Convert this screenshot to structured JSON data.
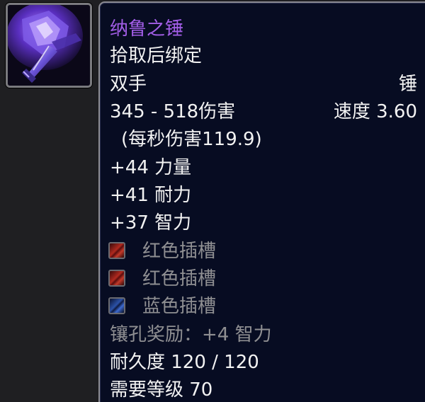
{
  "item": {
    "icon": "purple-crystal-mace-icon",
    "name": "纳鲁之锤",
    "binding": "拾取后绑定",
    "slot": "双手",
    "weapon_type": "锤",
    "damage": "345 - 518伤害",
    "speed": "速度 3.60",
    "dps": "(每秒伤害119.9)",
    "stats": [
      "+44 力量",
      "+41 耐力",
      "+37 智力"
    ],
    "sockets": [
      {
        "color": "red",
        "label": "红色插槽"
      },
      {
        "color": "red",
        "label": "红色插槽"
      },
      {
        "color": "blue",
        "label": "蓝色插槽"
      }
    ],
    "socket_bonus": "镶孔奖励：+4 智力",
    "durability": "耐久度 120 / 120",
    "required_level": "需要等级 70"
  },
  "colors": {
    "item_name": "#a35ee8",
    "text": "#f2f2f2",
    "inactive": "#8f8f92",
    "tooltip_bg": "#070c22",
    "socket_red": "#b02a1f",
    "socket_blue": "#2b52a8"
  }
}
